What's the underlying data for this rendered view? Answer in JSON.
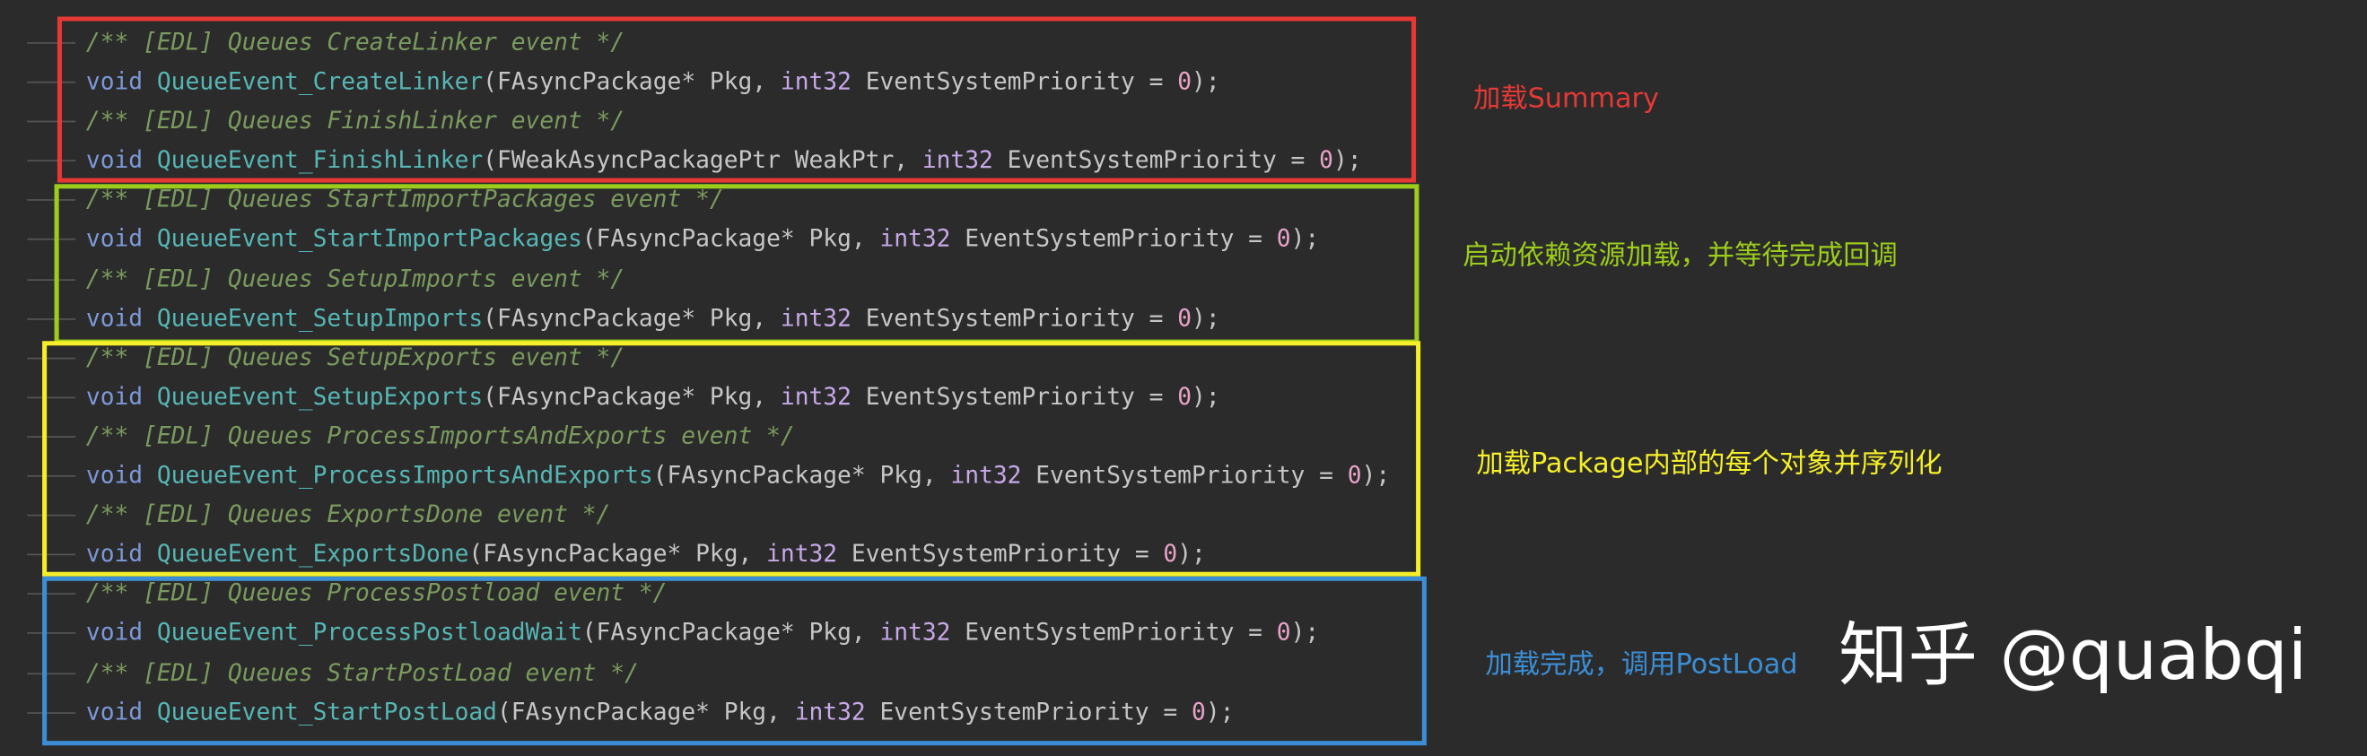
{
  "colors": {
    "red": "#e53935",
    "green": "#9ccc1c",
    "yellow": "#f5ef2a",
    "blue": "#3b8ed6",
    "comment": "#7a9a5e",
    "keyword": "#7c98d8",
    "function": "#56b6b4",
    "type": "#c7a8e8",
    "number": "#e8a2c8"
  },
  "lines": [
    {
      "comment": "/** [EDL] Queues CreateLinker event */"
    },
    {
      "kw": "void",
      "fn": "QueueEvent_CreateLinker",
      "ptype": "FAsyncPackage*",
      "pname": "Pkg",
      "prio": "int32",
      "pv": "EventSystemPriority",
      "num": "0"
    },
    {
      "comment": "/** [EDL] Queues FinishLinker event */"
    },
    {
      "kw": "void",
      "fn": "QueueEvent_FinishLinker",
      "ptype": "FWeakAsyncPackagePtr",
      "pname": "WeakPtr",
      "prio": "int32",
      "pv": "EventSystemPriority",
      "num": "0"
    },
    {
      "comment": "/** [EDL] Queues StartImportPackages event */"
    },
    {
      "kw": "void",
      "fn": "QueueEvent_StartImportPackages",
      "ptype": "FAsyncPackage*",
      "pname": "Pkg",
      "prio": "int32",
      "pv": "EventSystemPriority",
      "num": "0"
    },
    {
      "comment": "/** [EDL] Queues SetupImports event */"
    },
    {
      "kw": "void",
      "fn": "QueueEvent_SetupImports",
      "ptype": "FAsyncPackage*",
      "pname": "Pkg",
      "prio": "int32",
      "pv": "EventSystemPriority",
      "num": "0"
    },
    {
      "comment": "/** [EDL] Queues SetupExports event */"
    },
    {
      "kw": "void",
      "fn": "QueueEvent_SetupExports",
      "ptype": "FAsyncPackage*",
      "pname": "Pkg",
      "prio": "int32",
      "pv": "EventSystemPriority",
      "num": "0"
    },
    {
      "comment": "/** [EDL] Queues ProcessImportsAndExports event */"
    },
    {
      "kw": "void",
      "fn": "QueueEvent_ProcessImportsAndExports",
      "ptype": "FAsyncPackage*",
      "pname": "Pkg",
      "prio": "int32",
      "pv": "EventSystemPriority",
      "num": "0"
    },
    {
      "comment": "/** [EDL] Queues ExportsDone event */"
    },
    {
      "kw": "void",
      "fn": "QueueEvent_ExportsDone",
      "ptype": "FAsyncPackage*",
      "pname": "Pkg",
      "prio": "int32",
      "pv": "EventSystemPriority",
      "num": "0"
    },
    {
      "comment": "/** [EDL] Queues ProcessPostload event */"
    },
    {
      "kw": "void",
      "fn": "QueueEvent_ProcessPostloadWait",
      "ptype": "FAsyncPackage*",
      "pname": "Pkg",
      "prio": "int32",
      "pv": "EventSystemPriority",
      "num": "0"
    },
    {
      "comment": "/** [EDL] Queues StartPostLoad event */"
    },
    {
      "kw": "void",
      "fn": "QueueEvent_StartPostLoad",
      "ptype": "FAsyncPackage*",
      "pname": "Pkg",
      "prio": "int32",
      "pv": "EventSystemPriority",
      "num": "0"
    }
  ],
  "annotations": {
    "red": "加载Summary",
    "green": "启动依赖资源加载，并等待完成回调",
    "yellow": "加载Package内部的每个对象并序列化",
    "blue": "加载完成，调用PostLoad"
  },
  "watermark": "知乎 @quabqi"
}
